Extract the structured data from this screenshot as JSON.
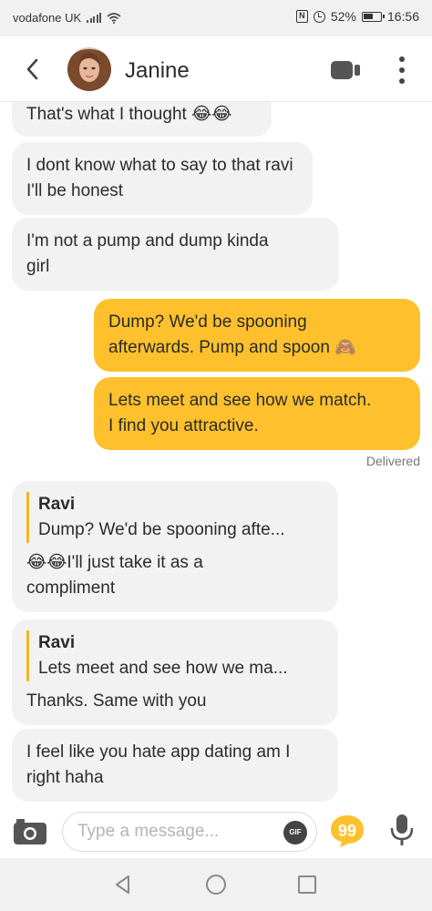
{
  "status_bar": {
    "carrier": "vodafone UK",
    "battery_percent": "52%",
    "time": "16:56",
    "icons": [
      "signal-icon",
      "wifi-icon",
      "nfc-icon",
      "alarm-icon",
      "battery-icon"
    ]
  },
  "header": {
    "contact_name": "Janine",
    "icons": [
      "back-icon",
      "avatar",
      "video-call-icon",
      "more-icon"
    ]
  },
  "messages": [
    {
      "side": "in",
      "text": "That's what I thought",
      "emoji": "😂😂"
    },
    {
      "side": "in",
      "lines": [
        "I dont know what to say to that ravi",
        "I'll be honest"
      ]
    },
    {
      "side": "in",
      "lines": [
        "I'm not a pump and dump kinda",
        "girl"
      ]
    },
    {
      "side": "out",
      "lines": [
        "Dump? We'd be spooning",
        "afterwards. Pump and spoon"
      ],
      "emoji": "🙈"
    },
    {
      "side": "out",
      "lines": [
        "Lets meet and see how we match.",
        "I find you attractive."
      ]
    },
    {
      "side": "in",
      "reply_to": {
        "name": "Ravi",
        "text": "Dump? We'd be spooning afte..."
      },
      "emoji": "😂😂",
      "lines": [
        "I'll just take it as a",
        "compliment"
      ]
    },
    {
      "side": "in",
      "reply_to": {
        "name": "Ravi",
        "text": "Lets meet and see how we ma..."
      },
      "lines": [
        "Thanks. Same with you"
      ]
    },
    {
      "side": "in",
      "lines": [
        "I feel like you hate app dating am I",
        "right haha"
      ]
    }
  ],
  "delivered_label": "Delivered",
  "composer": {
    "placeholder": "Type a message...",
    "gif_label": "GIF",
    "icons": [
      "camera-icon",
      "gif-icon",
      "quote-icon",
      "microphone-icon"
    ]
  },
  "colors": {
    "outgoing_bubble": "#fec12d",
    "incoming_bubble": "#f2f2f2",
    "reply_bar": "#f3b81f"
  },
  "nav_bar": {
    "icons": [
      "nav-back-icon",
      "nav-home-icon",
      "nav-recents-icon"
    ]
  }
}
